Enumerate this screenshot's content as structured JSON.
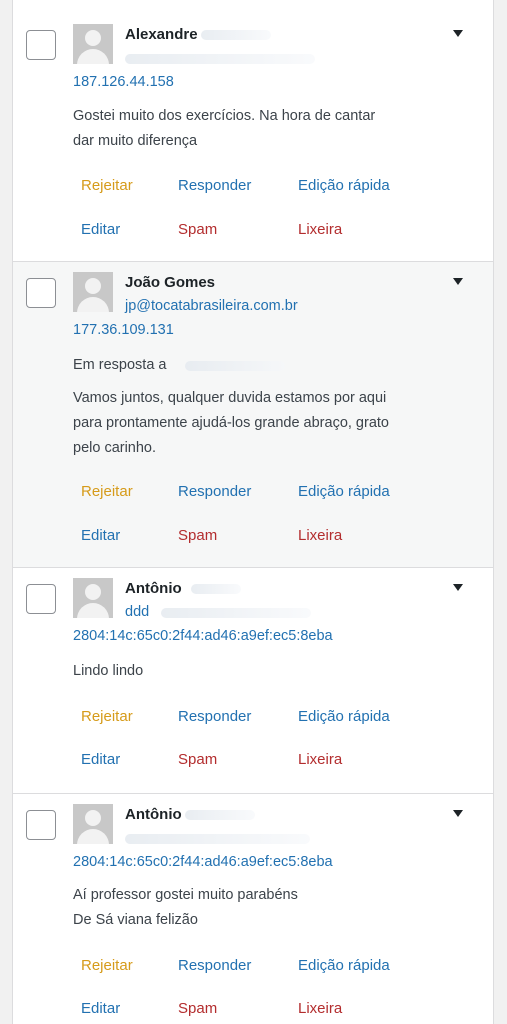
{
  "actions": {
    "reject": "Rejeitar",
    "reply": "Responder",
    "quick_edit": "Edição rápida",
    "edit": "Editar",
    "spam": "Spam",
    "trash": "Lixeira"
  },
  "comments": [
    {
      "author": "Alexandre",
      "email": "",
      "ip": "187.126.44.158",
      "reply_to": "",
      "text_lines": [
        "Gostei muito dos exercícios. Na hora de cantar",
        "dar muito diferença"
      ]
    },
    {
      "author": "João Gomes",
      "email": "jp@tocatabrasileira.com.br",
      "ip": "177.36.109.131",
      "reply_to": "Em resposta a",
      "text_lines": [
        "Vamos juntos, qualquer duvida estamos por aqui",
        "para prontamente ajudá-los grande abraço, grato",
        "pelo carinho."
      ]
    },
    {
      "author": "Antônio",
      "email": "ddd",
      "ip": "2804:14c:65c0:2f44:ad46:a9ef:ec5:8eba",
      "reply_to": "",
      "text_lines": [
        "Lindo lindo"
      ]
    },
    {
      "author": "Antônio",
      "email": "",
      "ip": "2804:14c:65c0:2f44:ad46:a9ef:ec5:8eba",
      "reply_to": "",
      "text_lines": [
        "Aí professor gostei muito parabéns",
        "De Sá viana felizão"
      ]
    }
  ]
}
